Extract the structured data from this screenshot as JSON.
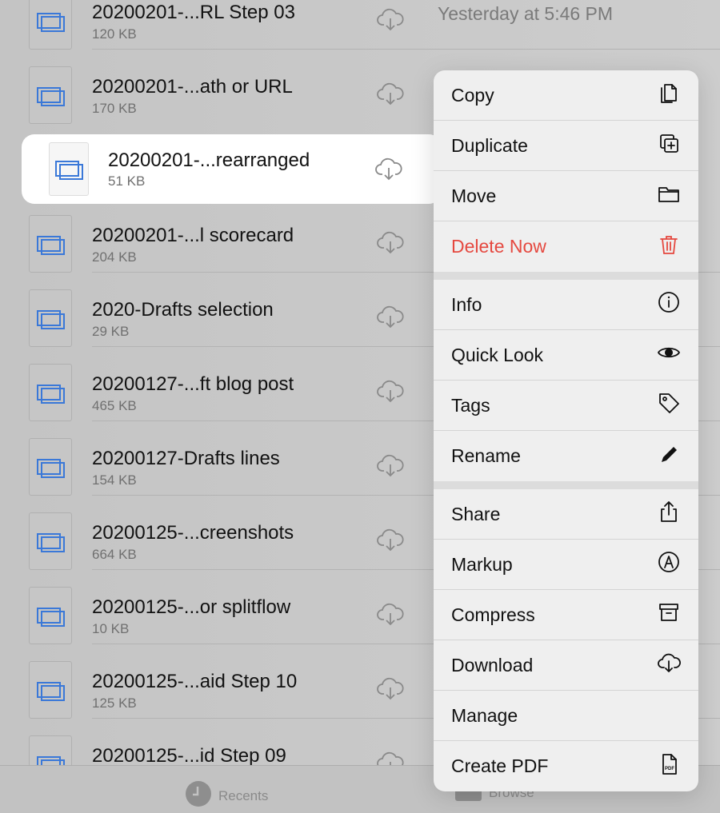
{
  "files": [
    {
      "name": "20200201-...RL Step 03",
      "size": "120 KB",
      "date": "Yesterday at 5:46 PM"
    },
    {
      "name": "20200201-...ath or URL",
      "size": "170 KB"
    },
    {
      "name": "20200201-...rearranged",
      "size": "51 KB",
      "selected": true
    },
    {
      "name": "20200201-...l scorecard",
      "size": "204 KB"
    },
    {
      "name": "2020-Drafts selection",
      "size": "29 KB"
    },
    {
      "name": "20200127-...ft blog post",
      "size": "465 KB"
    },
    {
      "name": "20200127-Drafts lines",
      "size": "154 KB"
    },
    {
      "name": "20200125-...creenshots",
      "size": "664 KB"
    },
    {
      "name": "20200125-...or splitflow",
      "size": "10 KB"
    },
    {
      "name": "20200125-...aid Step 10",
      "size": "125 KB"
    },
    {
      "name": "20200125-...id Step 09",
      "size": ""
    }
  ],
  "tabbar": {
    "recents": "Recents",
    "browse": "Browse"
  },
  "menu": [
    [
      {
        "label": "Copy",
        "icon": "copy"
      },
      {
        "label": "Duplicate",
        "icon": "duplicate"
      },
      {
        "label": "Move",
        "icon": "folder"
      },
      {
        "label": "Delete Now",
        "icon": "trash",
        "destructive": true
      }
    ],
    [
      {
        "label": "Info",
        "icon": "info"
      },
      {
        "label": "Quick Look",
        "icon": "eye"
      },
      {
        "label": "Tags",
        "icon": "tag"
      },
      {
        "label": "Rename",
        "icon": "pencil"
      }
    ],
    [
      {
        "label": "Share",
        "icon": "share"
      },
      {
        "label": "Markup",
        "icon": "markup"
      },
      {
        "label": "Compress",
        "icon": "archive"
      },
      {
        "label": "Download",
        "icon": "cloud-download"
      },
      {
        "label": "Manage",
        "icon": ""
      },
      {
        "label": "Create PDF",
        "icon": "pdf"
      }
    ]
  ],
  "colors": {
    "destructive": "#e5483f",
    "file_icon": "#3a78d8"
  }
}
